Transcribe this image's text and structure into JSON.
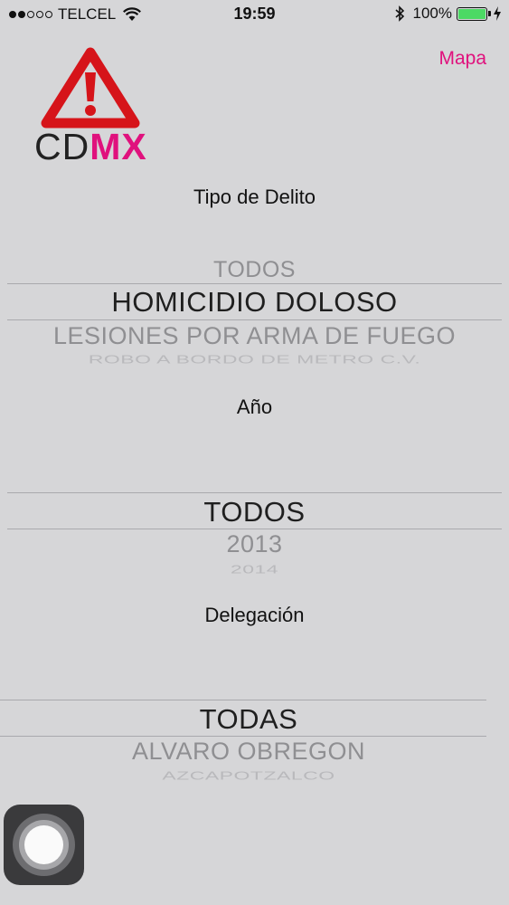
{
  "status_bar": {
    "carrier": "TELCEL",
    "time": "19:59",
    "battery": "100%"
  },
  "logo": {
    "text_left": "CD",
    "text_right": "MX"
  },
  "nav": {
    "map_link": "Mapa"
  },
  "crime_type": {
    "label": "Tipo de Delito",
    "prev": "TODOS",
    "selected": "HOMICIDIO DOLOSO",
    "next1": "LESIONES POR ARMA DE FUEGO",
    "next2": "ROBO A BORDO DE METRO C.V."
  },
  "year": {
    "label": "Año",
    "selected": "TODOS",
    "next1": "2013",
    "next2": "2014"
  },
  "delegation": {
    "label": "Delegación",
    "selected": "TODAS",
    "next1": "ALVARO OBREGON",
    "next2": "AZCAPOTZALCO"
  },
  "colors": {
    "accent": "#e0117d",
    "logo_red": "#d6141a",
    "background": "#d6d6d8"
  }
}
